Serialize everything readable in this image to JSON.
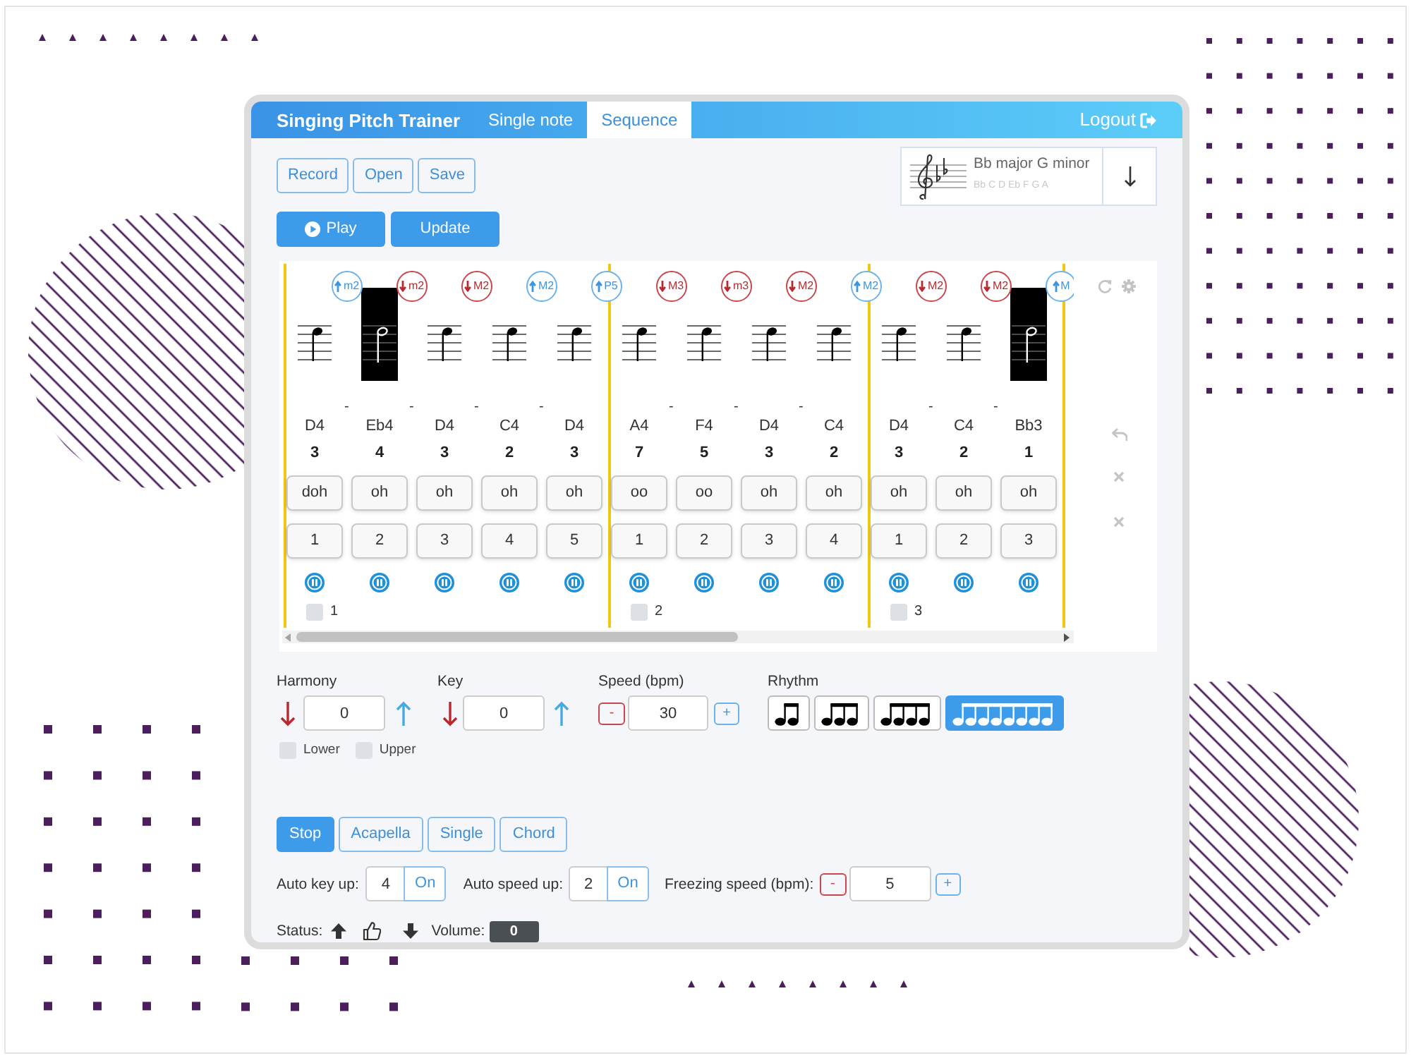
{
  "window": {
    "title": "Singing Pitch Trainer",
    "tabs": [
      {
        "label": "Single note",
        "selected": false
      },
      {
        "label": "Sequence",
        "selected": true
      }
    ],
    "logout": "Logout"
  },
  "file_buttons": [
    {
      "label": "Record"
    },
    {
      "label": "Open"
    },
    {
      "label": "Save"
    }
  ],
  "playback_buttons": [
    {
      "label": "Play",
      "kind": "play"
    },
    {
      "label": "Update",
      "kind": "text"
    }
  ],
  "key_selector": {
    "name": "Bb major G minor",
    "scale": "Bb C D Eb F G A"
  },
  "score": {
    "groups": [
      {
        "label": "1",
        "checked": false,
        "notes": [
          {
            "pitch": "D4",
            "degree": "3",
            "syllable": "doh",
            "count": "1",
            "highlighted": false,
            "dash": "-"
          },
          {
            "interval": {
              "label": "m2",
              "kind": "up"
            },
            "pitch": "Eb4",
            "degree": "4",
            "syllable": "oh",
            "count": "2",
            "highlighted": true,
            "dash": "-"
          },
          {
            "interval": {
              "label": "m2",
              "kind": "down"
            },
            "pitch": "D4",
            "degree": "3",
            "syllable": "oh",
            "count": "3",
            "highlighted": false,
            "dash": "-"
          },
          {
            "interval": {
              "label": "M2",
              "kind": "down"
            },
            "pitch": "C4",
            "degree": "2",
            "syllable": "oh",
            "count": "4",
            "highlighted": false,
            "dash": "-"
          },
          {
            "interval": {
              "label": "M2",
              "kind": "up"
            },
            "pitch": "D4",
            "degree": "3",
            "syllable": "oh",
            "count": "5",
            "highlighted": false
          }
        ]
      },
      {
        "label": "2",
        "checked": false,
        "notes": [
          {
            "interval": {
              "label": "P5",
              "kind": "up"
            },
            "pitch": "A4",
            "degree": "7",
            "syllable": "oo",
            "count": "1",
            "highlighted": false,
            "dash": "-"
          },
          {
            "interval": {
              "label": "M3",
              "kind": "down"
            },
            "pitch": "F4",
            "degree": "5",
            "syllable": "oo",
            "count": "2",
            "highlighted": false,
            "dash": "-"
          },
          {
            "interval": {
              "label": "m3",
              "kind": "down"
            },
            "pitch": "D4",
            "degree": "3",
            "syllable": "oh",
            "count": "3",
            "highlighted": false,
            "dash": "-"
          },
          {
            "interval": {
              "label": "M2",
              "kind": "down"
            },
            "pitch": "C4",
            "degree": "2",
            "syllable": "oh",
            "count": "4",
            "highlighted": false
          }
        ]
      },
      {
        "label": "3",
        "checked": false,
        "notes": [
          {
            "interval": {
              "label": "M2",
              "kind": "up"
            },
            "pitch": "D4",
            "degree": "3",
            "syllable": "oh",
            "count": "1",
            "highlighted": false,
            "dash": "-"
          },
          {
            "interval": {
              "label": "M2",
              "kind": "down"
            },
            "pitch": "C4",
            "degree": "2",
            "syllable": "oh",
            "count": "2",
            "highlighted": false,
            "dash": "-"
          },
          {
            "interval": {
              "label": "M2",
              "kind": "down"
            },
            "pitch": "Bb3",
            "degree": "1",
            "syllable": "oh",
            "count": "3",
            "highlighted": true
          }
        ]
      }
    ],
    "next_interval": {
      "label": "M",
      "kind": "up"
    }
  },
  "harmony": {
    "label": "Harmony",
    "value": "0",
    "voices": [
      {
        "label": "Lower",
        "checked": false
      },
      {
        "label": "Upper",
        "checked": false
      }
    ]
  },
  "key": {
    "label": "Key",
    "value": "0"
  },
  "speed": {
    "label": "Speed (bpm)",
    "decrease": "-",
    "value": "30",
    "increase": "+"
  },
  "rhythm": {
    "label": "Rhythm",
    "options": [
      {
        "kind": "two",
        "selected": false
      },
      {
        "kind": "three",
        "selected": false
      },
      {
        "kind": "four",
        "selected": false
      },
      {
        "kind": "eight",
        "selected": true
      }
    ]
  },
  "modes": [
    {
      "label": "Stop",
      "selected": true
    },
    {
      "label": "Acapella",
      "selected": false
    },
    {
      "label": "Single",
      "selected": false
    },
    {
      "label": "Chord",
      "selected": false
    }
  ],
  "auto_key_up": {
    "label": "Auto key up:",
    "value": "4",
    "toggle": "On"
  },
  "auto_speed_up": {
    "label": "Auto speed up:",
    "value": "2",
    "toggle": "On"
  },
  "freezing_speed": {
    "label": "Freezing speed (bpm):",
    "decrease": "-",
    "value": "5",
    "increase": "+"
  },
  "status": {
    "label": "Status:",
    "volume_label": "Volume:",
    "volume": "0"
  }
}
